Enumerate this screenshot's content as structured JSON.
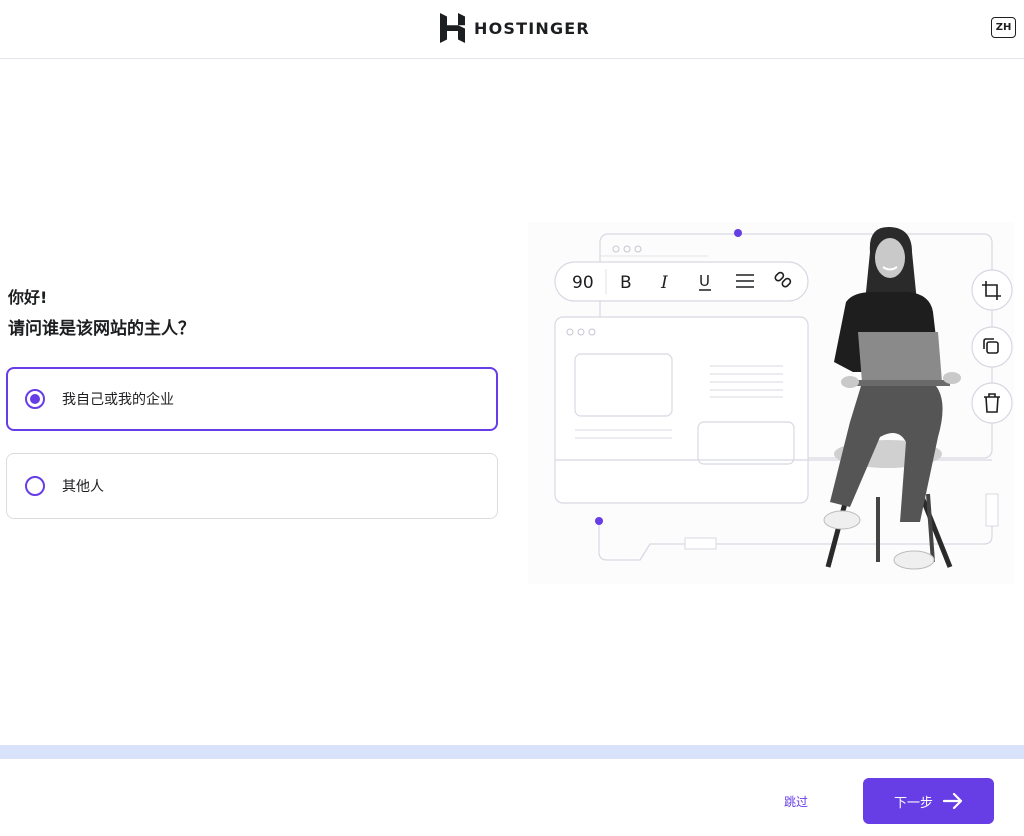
{
  "header": {
    "brand": "HOSTINGER",
    "language": "ZH"
  },
  "main": {
    "greeting": "你好!",
    "question": "请问谁是该网站的主人？",
    "options": [
      {
        "label": "我自己或我的企业",
        "selected": true
      },
      {
        "label": "其他人",
        "selected": false
      }
    ]
  },
  "illustration": {
    "toolbar": {
      "font_size": "90",
      "bold": "B",
      "italic": "I",
      "underline": "U",
      "icons": [
        "list-icon",
        "link-icon"
      ]
    },
    "side_tools": [
      "crop-icon",
      "copy-icon",
      "trash-icon"
    ]
  },
  "footer": {
    "skip": "跳过",
    "next": "下一步"
  },
  "colors": {
    "accent": "#673de6",
    "progress_track": "#d9e2fb",
    "text": "#1d1e20"
  }
}
